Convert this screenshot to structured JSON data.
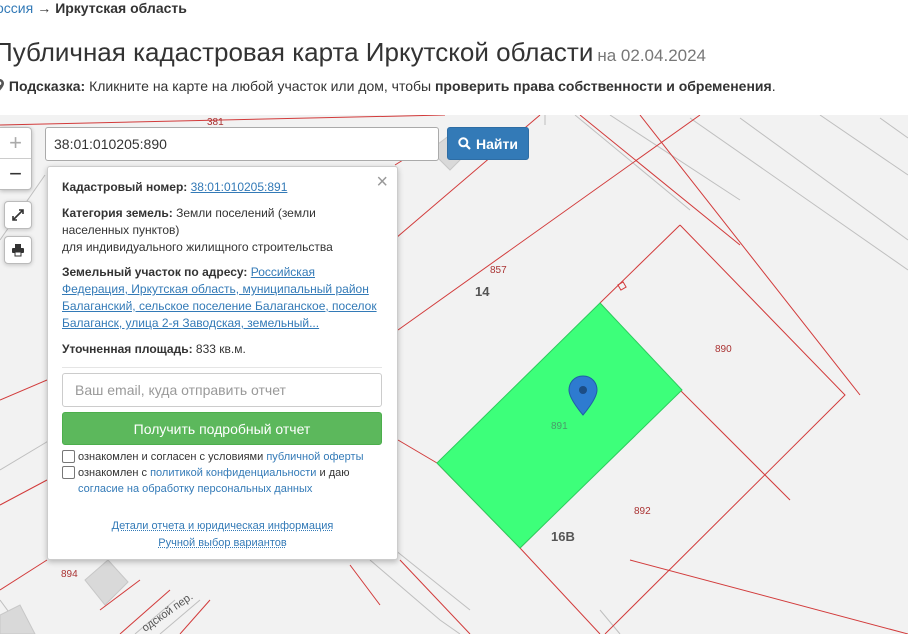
{
  "breadcrumb": {
    "parent": "оссия",
    "arrow": "→",
    "current": "Иркутская область"
  },
  "title": {
    "main": "Публичная кадастровая карта Иркутской области",
    "date": "на 02.04.2024"
  },
  "hint": {
    "label": "Подсказка:",
    "text": " Кликните на карте на любой участок или дом, чтобы ",
    "bold": "проверить права собственности и обременения",
    "end": "."
  },
  "search": {
    "value": "38:01:010205:890",
    "button": "Найти"
  },
  "map_controls": {
    "zoom_in": "+",
    "zoom_out": "−"
  },
  "map_labels": {
    "n381": "381",
    "n857": "857",
    "n14": "14",
    "n890": "890",
    "n891": "891",
    "n892": "892",
    "n16v": "16В",
    "n894": "894",
    "street": "одской пер."
  },
  "colors": {
    "selected_parcel": "#3dff7a",
    "parcel_border": "#d23b3b",
    "accent": "#337ab7",
    "success": "#5cb85c"
  },
  "popup": {
    "cadastral_label": "Кадастровый номер:",
    "cadastral_value": "38:01:010205:891",
    "category_label": "Категория земель:",
    "category_value": " Земли поселений (земли",
    "category_line2": "населенных пунктов)",
    "category_line3": "для индивидуального жилищного строительства",
    "address_label": "Земельный участок по адресу:",
    "address_line1": "Российская",
    "address_line2": "Федерация, Иркутская область, муниципальный район",
    "address_line3": "Балаганский, сельское поселение Балаганское, поселок",
    "address_line4": "Балаганск, улица 2-я Заводская, земельный...",
    "area_label": "Уточненная площадь:",
    "area_value": " 833 кв.м.",
    "email_placeholder": "Ваш email, куда отправить отчет",
    "report_button": "Получить подробный отчет",
    "agree1_text": "ознакомлен и согласен с условиями ",
    "agree1_link": "публичной оферты",
    "agree2_text": "ознакомлен с ",
    "agree2_link": "политикой конфиденциальности",
    "agree2_mid": " и даю",
    "agree2_link2": "согласие на обработку персональных данных",
    "details_link": "Детали отчета и юридическая информация",
    "manual_link": "Ручной выбор вариантов"
  }
}
